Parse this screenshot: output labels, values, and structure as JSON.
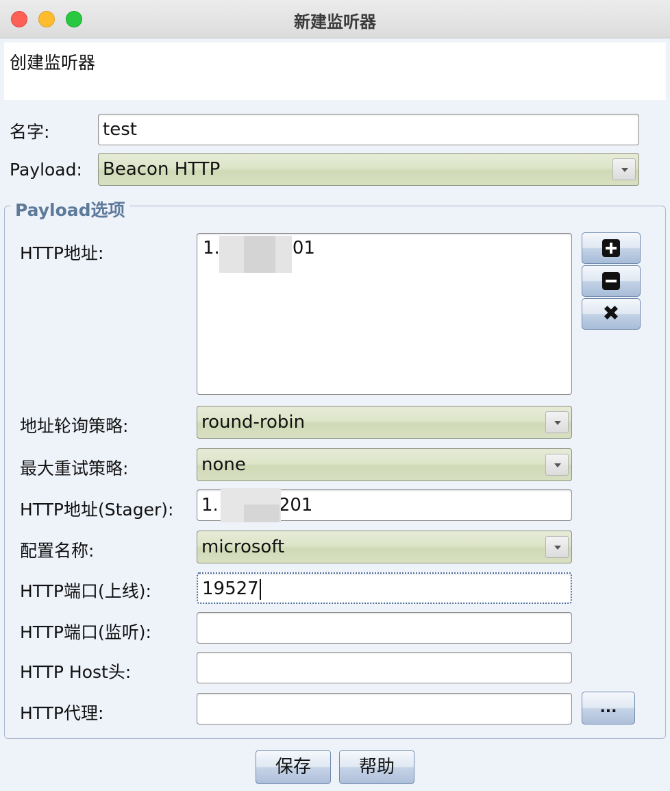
{
  "window": {
    "title": "新建监听器"
  },
  "banner": {
    "text": "创建监听器"
  },
  "name_field": {
    "label": "名字:",
    "value": "test"
  },
  "payload_field": {
    "label": "Payload:",
    "value": "Beacon HTTP"
  },
  "options": {
    "legend": "Payload选项",
    "http_hosts": {
      "label": "HTTP地址:",
      "value_prefix": "1.",
      "value_suffix": "01"
    },
    "rotation": {
      "label": "地址轮询策略:",
      "value": "round-robin"
    },
    "max_retry": {
      "label": "最大重试策略:",
      "value": "none"
    },
    "stager_host": {
      "label": "HTTP地址(Stager):",
      "value_prefix": "1.",
      "value_suffix": "201"
    },
    "profile": {
      "label": "配置名称:",
      "value": "microsoft"
    },
    "port_c2": {
      "label": "HTTP端口(上线):",
      "value": "19527"
    },
    "port_bind": {
      "label": "HTTP端口(监听):",
      "value": ""
    },
    "host_header": {
      "label": "HTTP Host头:",
      "value": ""
    },
    "proxy": {
      "label": "HTTP代理:",
      "value": "",
      "button_label": "..."
    }
  },
  "buttons": {
    "save": "保存",
    "help": "帮助"
  },
  "colors": {
    "accent": "#5e7a9b",
    "combo_bg": "#dde5c9",
    "button_bg": "#c6d4e8"
  }
}
